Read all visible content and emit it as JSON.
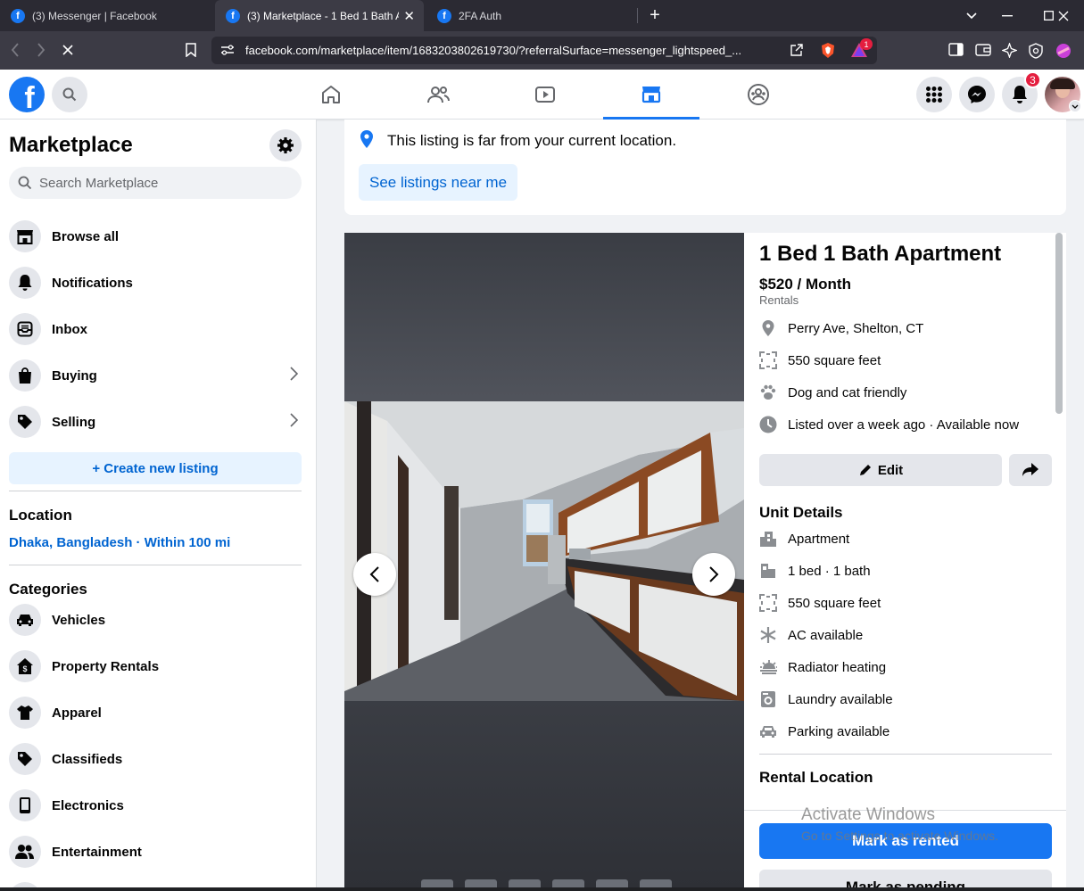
{
  "browser": {
    "tabs": [
      {
        "title": "(3) Messenger | Facebook"
      },
      {
        "title": "(3) Marketplace - 1 Bed 1 Bath A"
      },
      {
        "title": "2FA Auth"
      }
    ],
    "url": "facebook.com/marketplace/item/1683203802619730/?referralSurface=messenger_lightspeed_...",
    "extension_badge": "1"
  },
  "header": {
    "notification_count": "3"
  },
  "sidebar": {
    "title": "Marketplace",
    "search_placeholder": "Search Marketplace",
    "items": [
      {
        "label": "Browse all"
      },
      {
        "label": "Notifications"
      },
      {
        "label": "Inbox"
      },
      {
        "label": "Buying"
      },
      {
        "label": "Selling"
      }
    ],
    "create_label": "+ Create new listing",
    "location_heading": "Location",
    "location_value": "Dhaka, Bangladesh · Within 100 mi",
    "categories_heading": "Categories",
    "categories": [
      {
        "label": "Vehicles"
      },
      {
        "label": "Property Rentals"
      },
      {
        "label": "Apparel"
      },
      {
        "label": "Classifieds"
      },
      {
        "label": "Electronics"
      },
      {
        "label": "Entertainment"
      }
    ]
  },
  "notice": {
    "text": "This listing is far from your current location.",
    "button": "See listings near me"
  },
  "listing": {
    "title": "1 Bed 1 Bath Apartment",
    "price": "$520 / Month",
    "category": "Rentals",
    "facts": [
      {
        "icon": "location-pin-icon",
        "text": "Perry Ave, Shelton, CT"
      },
      {
        "icon": "area-icon",
        "text": "550 square feet"
      },
      {
        "icon": "paw-icon",
        "text": "Dog and cat friendly"
      },
      {
        "icon": "clock-icon",
        "text": "Listed over a week ago · Available now"
      }
    ],
    "edit_label": "Edit",
    "unit_details_heading": "Unit Details",
    "unit_details": [
      {
        "icon": "building-icon",
        "text": "Apartment"
      },
      {
        "icon": "bed-icon",
        "text": "1 bed · 1 bath"
      },
      {
        "icon": "area-icon",
        "text": "550 square feet"
      },
      {
        "icon": "snowflake-icon",
        "text": "AC available"
      },
      {
        "icon": "heater-icon",
        "text": "Radiator heating"
      },
      {
        "icon": "washer-icon",
        "text": "Laundry available"
      },
      {
        "icon": "car-icon",
        "text": "Parking available"
      }
    ],
    "rental_location_heading": "Rental Location",
    "mark_rented": "Mark as rented",
    "mark_pending": "Mark as pending"
  },
  "watermark": {
    "line1": "Activate Windows",
    "line2": "Go to Settings to activate Windows."
  },
  "colors": {
    "brand": "#1877f2",
    "link": "#0064d1",
    "badge": "#e41e3f"
  }
}
